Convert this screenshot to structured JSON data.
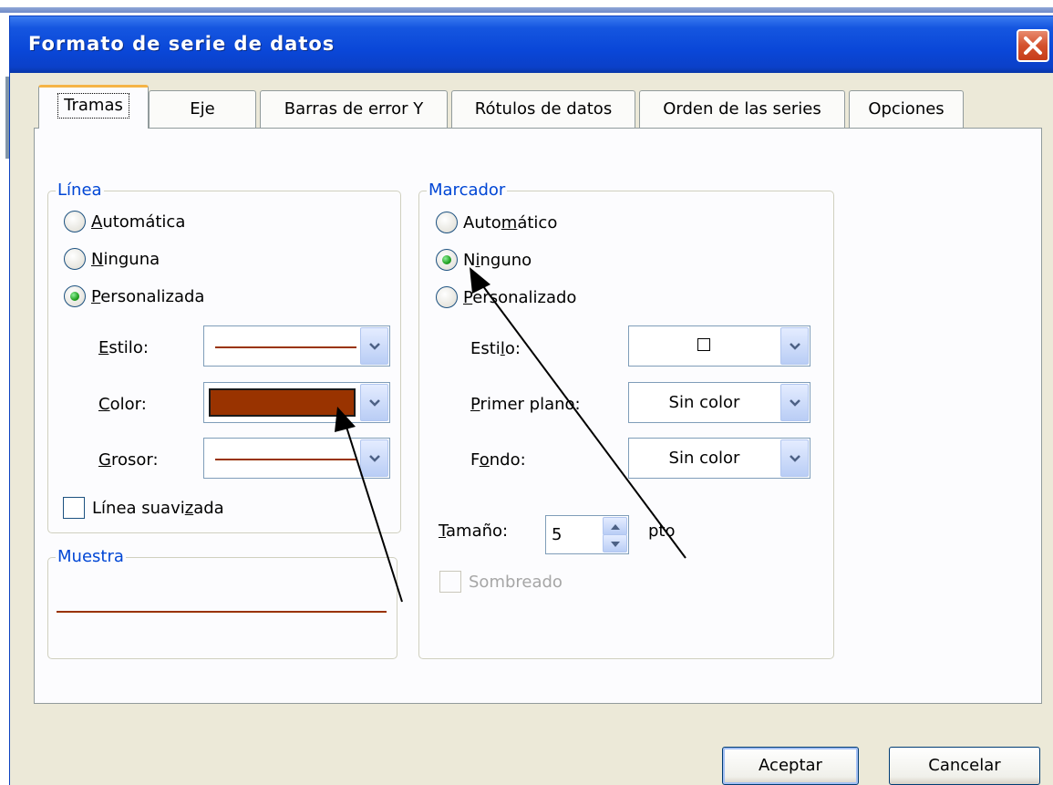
{
  "window": {
    "title": "Formato de serie de datos"
  },
  "tabs": [
    {
      "label": "Tramas",
      "active": true
    },
    {
      "label": "Eje"
    },
    {
      "label": "Barras de error Y"
    },
    {
      "label": "Rótulos de datos"
    },
    {
      "label": "Orden de las series"
    },
    {
      "label": "Opciones"
    }
  ],
  "linea": {
    "title": "Línea",
    "options": [
      {
        "pre": "",
        "key": "A",
        "post": "utomática",
        "selected": false
      },
      {
        "pre": "",
        "key": "N",
        "post": "inguna",
        "selected": false
      },
      {
        "pre": "",
        "key": "P",
        "post": "ersonalizada",
        "selected": true
      }
    ],
    "estilo": {
      "pre": "",
      "key": "E",
      "post": "stilo:"
    },
    "color": {
      "pre": "",
      "key": "C",
      "post": "olor:",
      "value_hex": "#993300"
    },
    "grosor": {
      "pre": "",
      "key": "G",
      "post": "rosor:"
    },
    "suavizada": {
      "pre": "Línea suavi",
      "key": "z",
      "post": "ada",
      "checked": false
    }
  },
  "muestra": {
    "title": "Muestra",
    "line_color": "#993300"
  },
  "marcador": {
    "title": "Marcador",
    "options": [
      {
        "pre": "Auto",
        "key": "m",
        "post": "ático",
        "selected": false
      },
      {
        "pre": "N",
        "key": "i",
        "post": "nguno",
        "selected": true
      },
      {
        "pre": "",
        "key": "P",
        "post": "ersonalizado",
        "selected": false
      }
    ],
    "estilo": {
      "pre": "Esti",
      "key": "l",
      "post": "o:"
    },
    "primer_plano": {
      "pre": "",
      "key": "P",
      "post": "rimer plano:",
      "value": "Sin color"
    },
    "fondo": {
      "pre": "F",
      "key": "o",
      "post": "ndo:",
      "value": "Sin color"
    },
    "tamano": {
      "pre": "",
      "key": "T",
      "post": "amaño:",
      "value": "5",
      "unit": "pto"
    },
    "sombreado": {
      "label": "Sombreado",
      "checked": false
    }
  },
  "buttons": {
    "ok": "Aceptar",
    "cancel": "Cancelar"
  },
  "colors": {
    "title_bar": "#0a47d8",
    "dialog_bg": "#ece9d8",
    "group_title": "#0046d5",
    "series": "#993300"
  },
  "icons": {
    "close": "close-x-icon",
    "dropdown": "chevron-down-icon",
    "spin_up": "triangle-up-icon",
    "spin_down": "triangle-down-icon",
    "annotation": "arrow-annotation"
  }
}
